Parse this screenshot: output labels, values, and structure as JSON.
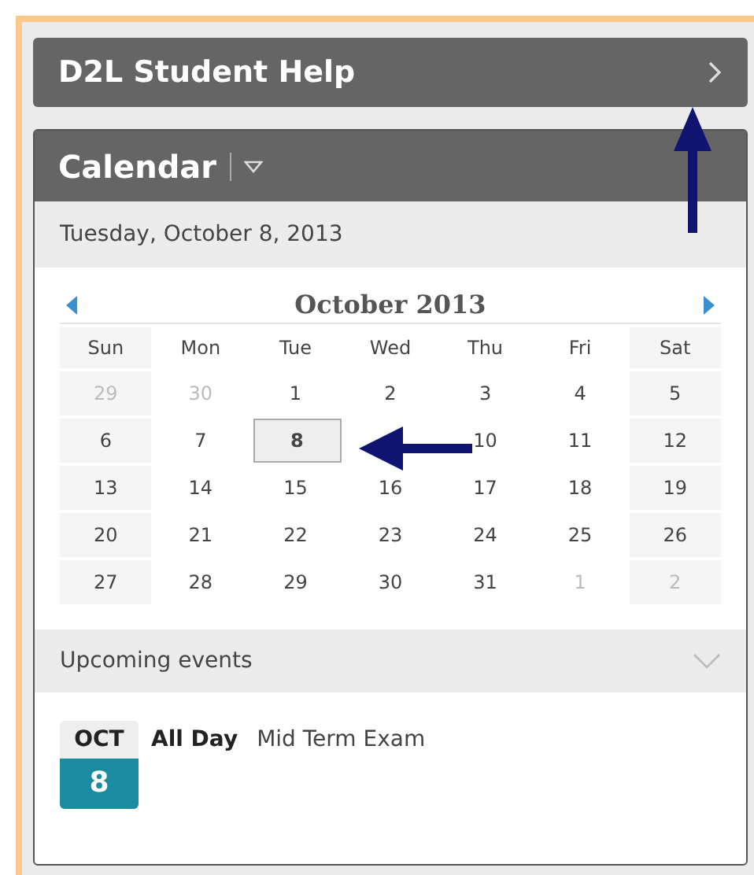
{
  "help_bar": {
    "title": "D2L Student Help"
  },
  "calendar": {
    "title": "Calendar",
    "date": "Tuesday, October 8, 2013",
    "month": "October 2013",
    "weekdays": [
      "Sun",
      "Mon",
      "Tue",
      "Wed",
      "Thu",
      "Fri",
      "Sat"
    ],
    "weeks": [
      [
        {
          "day": "29",
          "muted": true,
          "selected": false
        },
        {
          "day": "30",
          "muted": true,
          "selected": false
        },
        {
          "day": "1",
          "muted": false,
          "selected": false
        },
        {
          "day": "2",
          "muted": false,
          "selected": false
        },
        {
          "day": "3",
          "muted": false,
          "selected": false
        },
        {
          "day": "4",
          "muted": false,
          "selected": false
        },
        {
          "day": "5",
          "muted": false,
          "selected": false
        }
      ],
      [
        {
          "day": "6",
          "muted": false,
          "selected": false
        },
        {
          "day": "7",
          "muted": false,
          "selected": false
        },
        {
          "day": "8",
          "muted": false,
          "selected": true
        },
        {
          "covered": true
        },
        {
          "day": "10",
          "muted": false,
          "selected": false
        },
        {
          "day": "11",
          "muted": false,
          "selected": false
        },
        {
          "day": "12",
          "muted": false,
          "selected": false
        }
      ],
      [
        {
          "day": "13",
          "muted": false,
          "selected": false
        },
        {
          "day": "14",
          "muted": false,
          "selected": false
        },
        {
          "day": "15",
          "muted": false,
          "selected": false
        },
        {
          "day": "16",
          "muted": false,
          "selected": false
        },
        {
          "day": "17",
          "muted": false,
          "selected": false
        },
        {
          "day": "18",
          "muted": false,
          "selected": false
        },
        {
          "day": "19",
          "muted": false,
          "selected": false
        }
      ],
      [
        {
          "day": "20",
          "muted": false,
          "selected": false
        },
        {
          "day": "21",
          "muted": false,
          "selected": false
        },
        {
          "day": "22",
          "muted": false,
          "selected": false
        },
        {
          "day": "23",
          "muted": false,
          "selected": false
        },
        {
          "day": "24",
          "muted": false,
          "selected": false
        },
        {
          "day": "25",
          "muted": false,
          "selected": false
        },
        {
          "day": "26",
          "muted": false,
          "selected": false
        }
      ],
      [
        {
          "day": "27",
          "muted": false,
          "selected": false
        },
        {
          "day": "28",
          "muted": false,
          "selected": false
        },
        {
          "day": "29",
          "muted": false,
          "selected": false
        },
        {
          "day": "30",
          "muted": false,
          "selected": false
        },
        {
          "day": "31",
          "muted": false,
          "selected": false
        },
        {
          "day": "1",
          "muted": true,
          "selected": false
        },
        {
          "day": "2",
          "muted": true,
          "selected": false
        }
      ]
    ]
  },
  "upcoming": {
    "title": "Upcoming events",
    "events": [
      {
        "month": "OCT",
        "day": "8",
        "time": "All Day",
        "title": "Mid Term Exam"
      }
    ]
  }
}
